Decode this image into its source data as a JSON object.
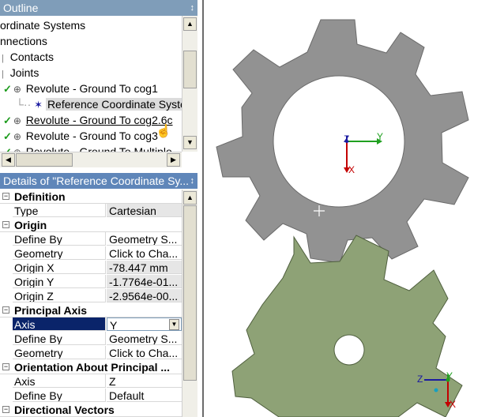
{
  "outline": {
    "title": "Outline",
    "pin": "↕",
    "items": [
      {
        "label": "ordinate Systems"
      },
      {
        "label": "nnections"
      },
      {
        "label": "Contacts"
      },
      {
        "label": "Joints"
      },
      {
        "label": "Revolute - Ground To cog1"
      },
      {
        "label": "Reference Coordinate Syste"
      },
      {
        "label": "Revolute - Ground To cog2.6c"
      },
      {
        "label": "Revolute - Ground To cog3"
      },
      {
        "label": "Revolute - Ground To Multiple"
      }
    ]
  },
  "details": {
    "title": "Details of \"Reference Coordinate Sy...",
    "pin": "↕",
    "sections": {
      "definition": "Definition",
      "origin": "Origin",
      "principal_axis": "Principal Axis",
      "orientation": "Orientation About Principal ...",
      "directional": "Directional Vectors"
    },
    "rows": {
      "type": {
        "name": "Type",
        "value": "Cartesian"
      },
      "define_by_1": {
        "name": "Define By",
        "value": "Geometry S..."
      },
      "geometry_1": {
        "name": "Geometry",
        "value": "Click to Cha..."
      },
      "origin_x": {
        "name": "Origin X",
        "value": "-78.447 mm"
      },
      "origin_y": {
        "name": "Origin Y",
        "value": "-1.7764e-01..."
      },
      "origin_z": {
        "name": "Origin Z",
        "value": "-2.9564e-00..."
      },
      "axis_1": {
        "name": "Axis",
        "value": "Y"
      },
      "define_by_2": {
        "name": "Define By",
        "value": "Geometry S..."
      },
      "geometry_2": {
        "name": "Geometry",
        "value": "Click to Cha..."
      },
      "axis_2": {
        "name": "Axis",
        "value": "Z"
      },
      "define_by_3": {
        "name": "Define By",
        "value": "Default"
      }
    }
  },
  "viewport": {
    "triad1": {
      "z": "Z",
      "y": "Y",
      "x": "X"
    },
    "triad2": {
      "z": "Z",
      "y": "Y",
      "x": "X"
    },
    "colors": {
      "top_gear": "#929292",
      "bottom_gear": "#8ea276",
      "x_axis": "#c40000",
      "y_axis": "#20a020",
      "z_axis": "#1a1aa0"
    }
  }
}
